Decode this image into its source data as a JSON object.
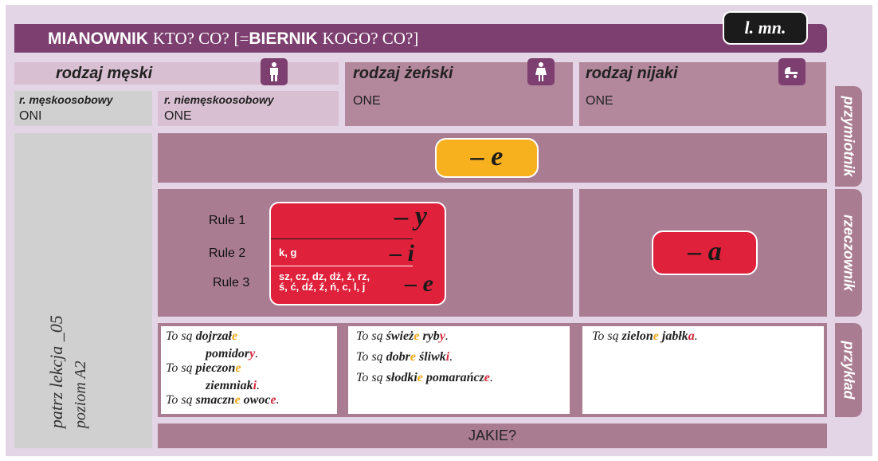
{
  "header": {
    "case": "MIANOWNIK",
    "q1": "KTO? CO?",
    "eq": "[=",
    "case2": "BIERNIK",
    "q2": "KOGO? CO?]",
    "number_badge": "l. mn."
  },
  "genders": {
    "masc": {
      "label": "rodzaj męski",
      "icon": "man-icon"
    },
    "fem": {
      "label": "rodzaj żeński",
      "icon": "woman-icon",
      "value": "ONE"
    },
    "neut": {
      "label": "rodzaj nijaki",
      "icon": "baby-carriage-icon",
      "value": "ONE"
    },
    "masc_personal": {
      "label": "r. męskoosobowy",
      "value": "ONI"
    },
    "masc_nonpersonal": {
      "label": "r. niemęskoosobowy",
      "value": "ONE"
    }
  },
  "side_note": {
    "line1": "patrz lekcja _05",
    "line2": "poziom A2"
  },
  "adjective": {
    "ending": "– e",
    "tab": "przymiotnik"
  },
  "noun": {
    "tab": "rzeczownik",
    "rules": [
      "Rule 1",
      "Rule 2",
      "Rule 3"
    ],
    "endings": [
      "– y",
      "– i",
      "– e"
    ],
    "rule2_letters": "k, g",
    "rule3_letters_1": "sz, cz, dz, dż, ż, rz,",
    "rule3_letters_2": "ś, ć, dź, ź, ń, c, l, j",
    "neuter_ending": "– a"
  },
  "examples": {
    "tab": "przykład",
    "col1": [
      {
        "pre": "To są ",
        "a1": "dojrzał",
        "a2": "e",
        "n1": "pomidor",
        "n2": "y",
        "end": "."
      },
      {
        "pre": "To są ",
        "a1": "pieczon",
        "a2": "e",
        "n1": "ziemniak",
        "n2": "i",
        "end": "."
      },
      {
        "pre": "To są ",
        "a1": "smaczn",
        "a2": "e",
        "n1": "owoc",
        "n2": "e",
        "end": "."
      }
    ],
    "col2": [
      {
        "pre": "To są ",
        "a1": "śwież",
        "a2": "e",
        "n1": "ryb",
        "n2": "y",
        "end": "."
      },
      {
        "pre": "To są ",
        "a1": "dobr",
        "a2": "e",
        "n1": "śliwk",
        "n2": "i",
        "end": "."
      },
      {
        "pre": "To są ",
        "a1": "słodki",
        "a2": "e",
        "n1": "pomarańcz",
        "n2": "e",
        "end": "."
      }
    ],
    "col3": [
      {
        "pre": "To są ",
        "a1": "zielon",
        "a2": "e",
        "n1": "jabłk",
        "n2": "a",
        "end": "."
      }
    ]
  },
  "footer": {
    "question": "JAKIE?"
  },
  "colors": {
    "plum": "#7c3f6f",
    "mauve": "#b3879c",
    "red": "#e0213b",
    "orange": "#f7b11e"
  }
}
